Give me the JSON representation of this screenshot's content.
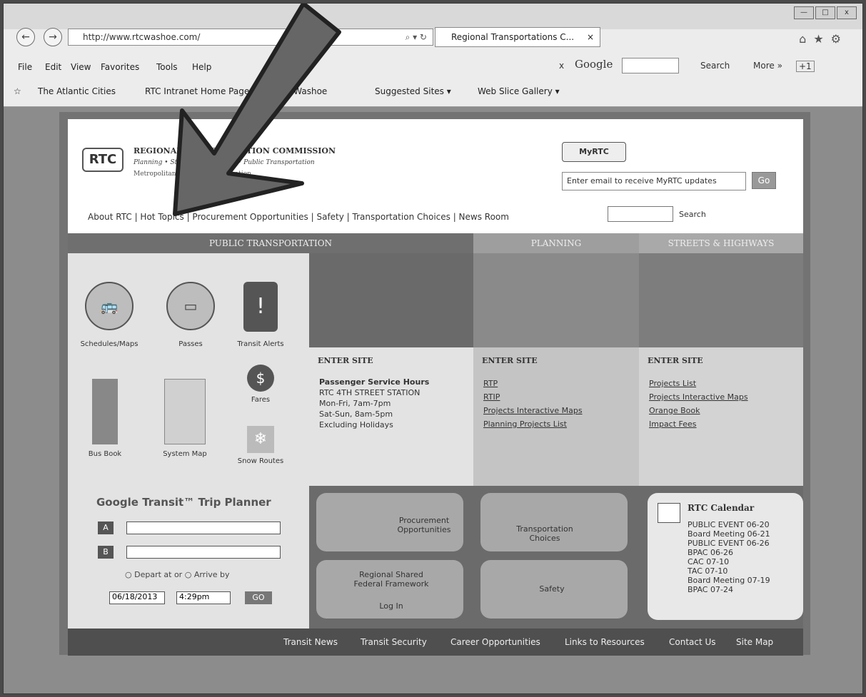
{
  "browser": {
    "address": "http://www.rtcwashoe.com/",
    "address_tools": "⌕ ▾ ↻",
    "tab_title": "Regional Transportations C...",
    "tab_close": "×",
    "menu": [
      "File",
      "Edit",
      "View",
      "Favorites",
      "Tools",
      "Help"
    ],
    "favorites": [
      "The Atlantic Cities",
      "RTC Intranet Home Page",
      "RTC Washoe",
      "Suggested Sites ▾",
      "Web Slice Gallery ▾"
    ],
    "google": {
      "x": "x",
      "label": "Google",
      "search": "Search",
      "more": "More »",
      "plus": "+1"
    }
  },
  "site": {
    "logo": "RTC",
    "org_name": "REGIONAL TRANSPORTATION COMMISSION",
    "org_tagline": "Planning • Streets & Highways • Public Transportation",
    "org_sub": "Metropolitan Planning Organization",
    "myrtc": "MyRTC",
    "email_placeholder": "Enter email to receive MyRTC updates",
    "go": "Go",
    "search_label": "Search",
    "topnav": "About RTC | Hot Topics | Procurement Opportunities | Safety | Transportation Choices | News Room"
  },
  "sections": {
    "public": "PUBLIC TRANSPORTATION",
    "planning": "PLANNING",
    "streets": "STREETS & HIGHWAYS"
  },
  "icons": {
    "schedules": "Schedules/Maps",
    "passes": "Passes",
    "alerts": "Transit Alerts",
    "busbook": "Bus Book",
    "systemmap": "System Map",
    "fares": "Fares",
    "snow": "Snow Routes"
  },
  "col1": {
    "enter": "ENTER SITE",
    "heading": "Passenger Service Hours",
    "l1": "RTC 4TH STREET STATION",
    "l2": "Mon-Fri, 7am-7pm",
    "l3": "Sat-Sun, 8am-5pm",
    "l4": "Excluding Holidays"
  },
  "col2": {
    "enter": "ENTER SITE",
    "links": [
      "RTP",
      "RTIP",
      "Projects Interactive Maps",
      "Planning Projects List"
    ]
  },
  "col3": {
    "enter": "ENTER SITE",
    "links": [
      "Projects List",
      "Projects Interactive Maps",
      "Orange Book",
      "Impact Fees"
    ]
  },
  "trip": {
    "title": "Google Transit™ Trip Planner",
    "a": "A",
    "b": "B",
    "depart": "Depart at or",
    "arrive": "Arrive by",
    "date": "06/18/2013",
    "time": "4:29pm",
    "go": "GO"
  },
  "tiles": {
    "procurement": "Procurement Opportunities",
    "transport": "Transportation Choices",
    "regional": "Regional Shared Federal Framework",
    "login": "Log In",
    "safety": "Safety"
  },
  "calendar": {
    "title": "RTC Calendar",
    "events": [
      "PUBLIC EVENT 06-20",
      "Board Meeting 06-21",
      "PUBLIC EVENT 06-26",
      "BPAC 06-26",
      "CAC 07-10",
      "TAC 07-10",
      "Board Meeting 07-19",
      "BPAC 07-24"
    ]
  },
  "footer": [
    "Transit News",
    "Transit Security",
    "Career Opportunities",
    "Links to Resources",
    "Contact Us",
    "Site Map"
  ]
}
